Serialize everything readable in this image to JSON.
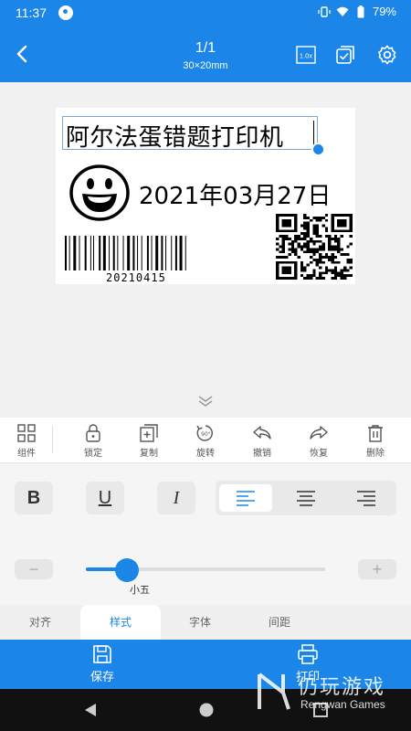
{
  "status": {
    "time": "11:37",
    "battery": "79%"
  },
  "header": {
    "title": "1/1",
    "subtitle": "30×20mm",
    "zoom_badge": "1.0x"
  },
  "label": {
    "title_text": "阿尔法蛋错题打印机",
    "date_text": "2021年03月27日",
    "barcode_number": "20210415"
  },
  "toolbar": {
    "items": [
      {
        "label": "组件",
        "icon": "grid-icon"
      },
      {
        "label": "锁定",
        "icon": "lock-icon"
      },
      {
        "label": "复制",
        "icon": "copy-icon"
      },
      {
        "label": "旋转",
        "icon": "rotate-icon"
      },
      {
        "label": "撤销",
        "icon": "undo-icon"
      },
      {
        "label": "恢复",
        "icon": "redo-icon"
      },
      {
        "label": "删除",
        "icon": "trash-icon"
      }
    ]
  },
  "format": {
    "bold": "B",
    "underline": "U",
    "italic": "I",
    "active_align": "left"
  },
  "font_size": {
    "label": "小五",
    "minus": "−",
    "plus": "+",
    "level": 0.17
  },
  "tabs": [
    {
      "label": "对齐"
    },
    {
      "label": "样式",
      "active": true
    },
    {
      "label": "字体"
    },
    {
      "label": "间距"
    }
  ],
  "bottom": {
    "save_label": "保存",
    "print_label": "打印"
  },
  "watermark": {
    "cn": "仍玩游戏",
    "en": "Rengwan Games"
  },
  "colors": {
    "accent": "#1b86e8"
  }
}
